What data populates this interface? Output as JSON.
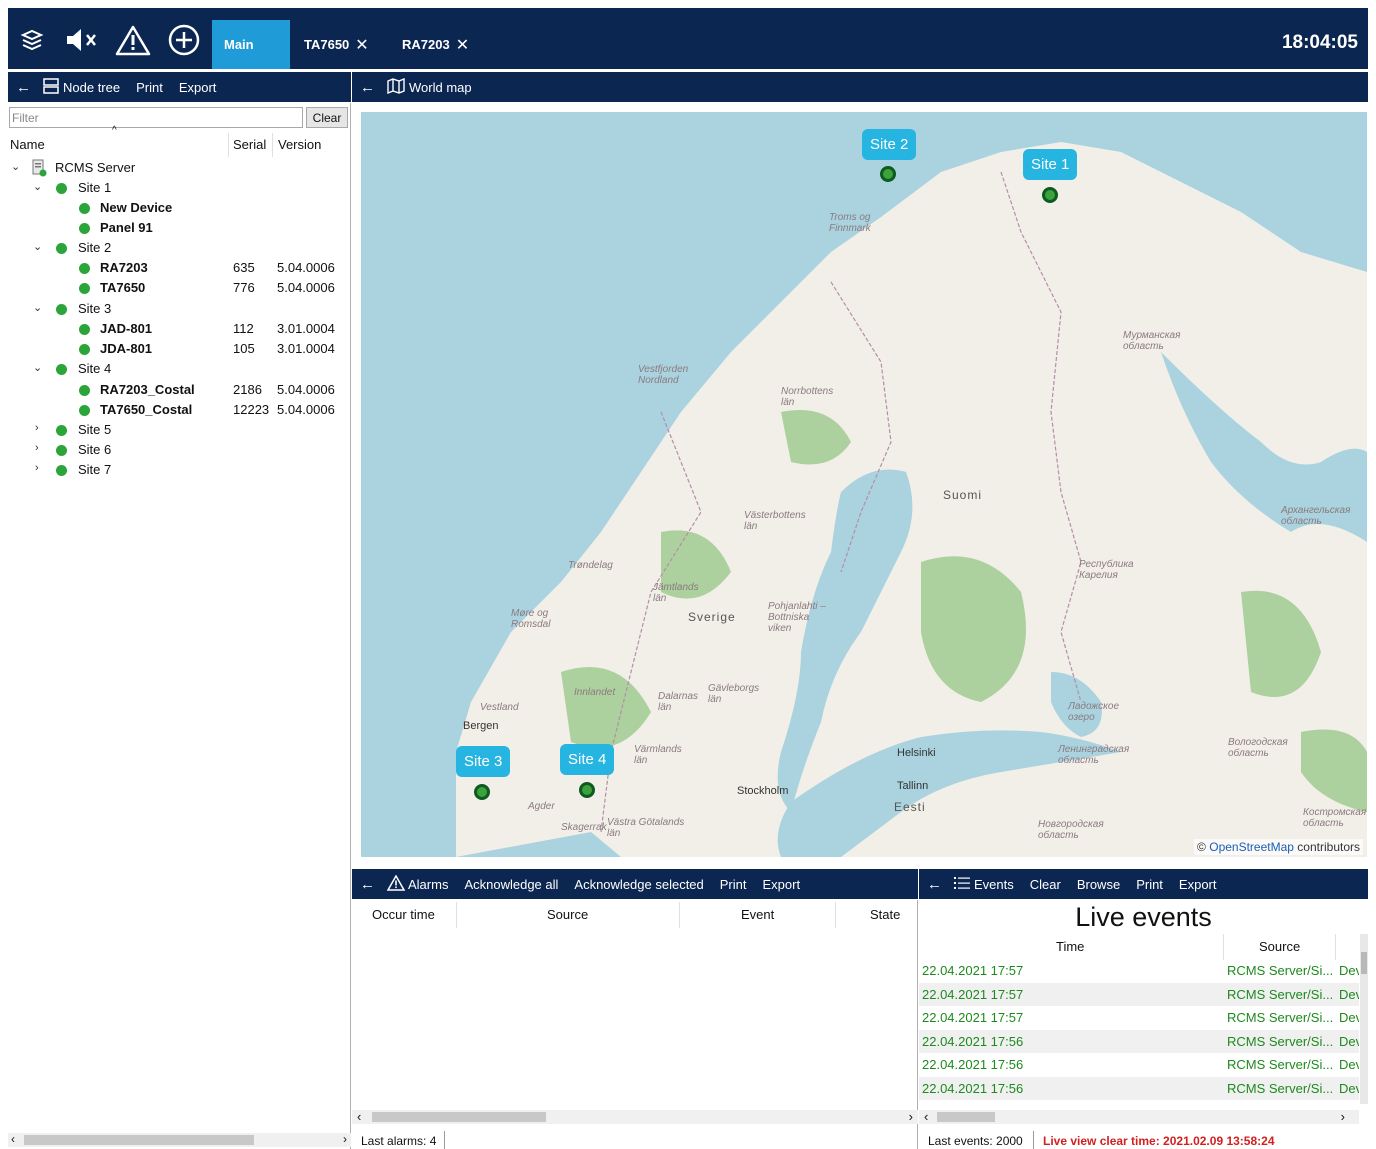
{
  "topbar": {
    "tabs": [
      {
        "label": "Main"
      },
      {
        "label": "TA7650"
      },
      {
        "label": "RA7203"
      }
    ],
    "clock": "18:04:05",
    "accent": "#1f9bd7",
    "bar_color": "#0c2652"
  },
  "left_panel": {
    "toolbar": {
      "node_tree": "Node tree",
      "print": "Print",
      "export": "Export"
    },
    "filter_placeholder": "Filter",
    "clear": "Clear",
    "columns": {
      "name": "Name",
      "serial": "Serial",
      "version": "Version"
    },
    "tree": [
      {
        "label": "RCMS Server",
        "serial": "",
        "version": "",
        "bold": false
      },
      {
        "label": "Site 1",
        "serial": "",
        "version": "",
        "bold": false
      },
      {
        "label": "New Device",
        "serial": "",
        "version": "",
        "bold": true
      },
      {
        "label": "Panel 91",
        "serial": "",
        "version": "",
        "bold": true
      },
      {
        "label": "Site 2",
        "serial": "",
        "version": "",
        "bold": false
      },
      {
        "label": "RA7203",
        "serial": "635",
        "version": "5.04.0006",
        "bold": true
      },
      {
        "label": "TA7650",
        "serial": "776",
        "version": "5.04.0006",
        "bold": true
      },
      {
        "label": "Site 3",
        "serial": "",
        "version": "",
        "bold": false
      },
      {
        "label": "JAD-801",
        "serial": "112",
        "version": "3.01.0004",
        "bold": true
      },
      {
        "label": "JDA-801",
        "serial": "105",
        "version": "3.01.0004",
        "bold": true
      },
      {
        "label": "Site 4",
        "serial": "",
        "version": "",
        "bold": false
      },
      {
        "label": "RA7203_Costal",
        "serial": "2186",
        "version": "5.04.0006",
        "bold": true
      },
      {
        "label": "TA7650_Costal",
        "serial": "12223",
        "version": "5.04.0006",
        "bold": true
      },
      {
        "label": "Site 5",
        "serial": "",
        "version": "",
        "bold": false
      },
      {
        "label": "Site 6",
        "serial": "",
        "version": "",
        "bold": false
      },
      {
        "label": "Site 7",
        "serial": "",
        "version": "",
        "bold": false
      }
    ]
  },
  "map_panel": {
    "title": "World map",
    "sites": [
      "Site 1",
      "Site 2",
      "Site 3",
      "Site 4"
    ],
    "labels": {
      "suomi": "Suomi",
      "sverige": "Sverige",
      "eesti": "Eesti",
      "bergen": "Bergen",
      "helsinki": "Helsinki",
      "tallinn": "Tallinn",
      "stockholm": "Stockholm",
      "troms": "Troms og Finnmark",
      "nordland": "Vestfjorden Nordland",
      "norrbotten": "Norrbottens län",
      "vasterbotten": "Västerbottens län",
      "trondelag": "Trøndelag",
      "jamtland": "Jämtlands län",
      "more": "Møre og Romsdal",
      "innlandet": "Innlandet",
      "dalarna": "Dalarnas län",
      "gavleborg": "Gävleborgs län",
      "vestland": "Vestland",
      "varmland": "Värmlands län",
      "agder": "Agder",
      "skagerrak": "Skagerrak",
      "vastra": "Västra Götalands län",
      "pohjanlahti": "Pohjanlahti – Bottniska viken",
      "murmansk": "Мурманская область",
      "arkhangelsk": "Архангельская область",
      "karelia": "Республика Карелия",
      "ladoga": "Ладожское озеро",
      "leningrad": "Ленинградская область",
      "vologda": "Вологодская область",
      "novgorod": "Новгородская область",
      "kostroma": "Костромская область"
    },
    "attribution_symbol": "©",
    "attribution_link": "OpenStreetMap",
    "attribution_rest": "contributors",
    "water_color": "#aad3df",
    "land_color": "#f2efe9",
    "forest_color": "#add19e"
  },
  "alarms_panel": {
    "toolbar": {
      "alarms": "Alarms",
      "ack_all": "Acknowledge all",
      "ack_selected": "Acknowledge selected",
      "print": "Print",
      "export": "Export"
    },
    "columns": [
      "Occur time",
      "Source",
      "Event",
      "State"
    ],
    "status": "Last alarms: 4"
  },
  "events_panel": {
    "toolbar": {
      "events": "Events",
      "clear": "Clear",
      "browse": "Browse",
      "print": "Print",
      "export": "Export"
    },
    "title": "Live events",
    "columns": [
      "Time",
      "Source"
    ],
    "rows": [
      {
        "time": "22.04.2021 17:57",
        "source": "RCMS Server/Si...",
        "extra": "Dev"
      },
      {
        "time": "22.04.2021 17:57",
        "source": "RCMS Server/Si...",
        "extra": "Dev"
      },
      {
        "time": "22.04.2021 17:57",
        "source": "RCMS Server/Si...",
        "extra": "Dev"
      },
      {
        "time": "22.04.2021 17:56",
        "source": "RCMS Server/Si...",
        "extra": "Dev"
      },
      {
        "time": "22.04.2021 17:56",
        "source": "RCMS Server/Si...",
        "extra": "Dev"
      },
      {
        "time": "22.04.2021 17:56",
        "source": "RCMS Server/Si...",
        "extra": "Dev"
      }
    ],
    "status": "Last events: 2000",
    "clear_time": "Live view clear time: 2021.02.09 13:58:24",
    "row_text_color": "#1d8a1d",
    "warning_color": "#d21f1f"
  }
}
